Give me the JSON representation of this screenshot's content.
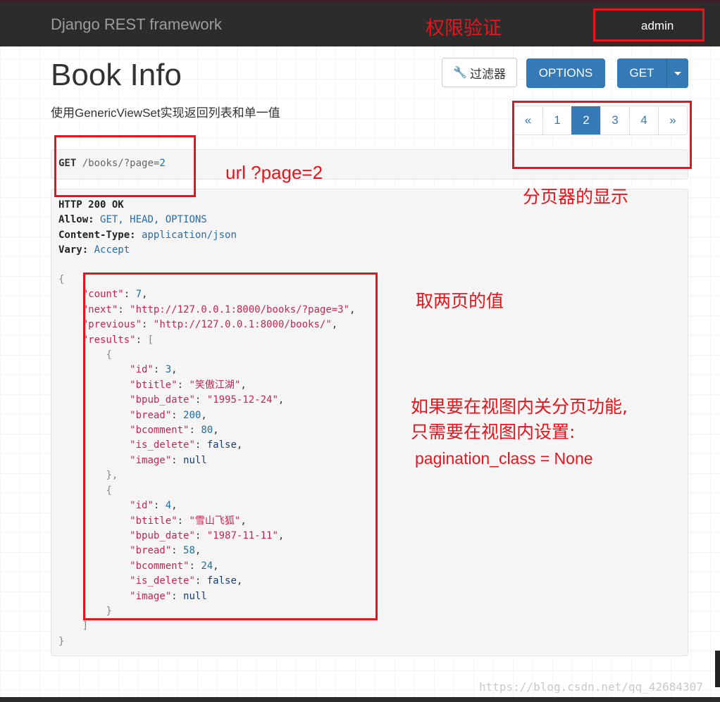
{
  "navbar": {
    "brand": "Django REST framework",
    "user": "admin"
  },
  "page": {
    "title": "Book Info",
    "description": "使用GenericViewSet实现返回列表和单一值"
  },
  "toolbar": {
    "filter_label": "过滤器",
    "options_label": "OPTIONS",
    "get_label": "GET"
  },
  "pagination": {
    "prev": "«",
    "pages": [
      "1",
      "2",
      "3",
      "4"
    ],
    "active": "2",
    "next": "»"
  },
  "request": {
    "method": "GET",
    "path": "/books/?page=",
    "page": "2"
  },
  "response": {
    "status": "HTTP 200 OK",
    "headers": [
      {
        "name": "Allow:",
        "value": "GET, HEAD, OPTIONS"
      },
      {
        "name": "Content-Type:",
        "value": "application/json"
      },
      {
        "name": "Vary:",
        "value": "Accept"
      }
    ],
    "body": {
      "count": 7,
      "next": "http://127.0.0.1:8000/books/?page=3",
      "previous": "http://127.0.0.1:8000/books/",
      "results": [
        {
          "id": 3,
          "btitle": "笑傲江湖",
          "bpub_date": "1995-12-24",
          "bread": 200,
          "bcomment": 80,
          "is_delete": "false",
          "image": "null"
        },
        {
          "id": 4,
          "btitle": "雪山飞狐",
          "bpub_date": "1987-11-11",
          "bread": 58,
          "bcomment": 24,
          "is_delete": "false",
          "image": "null"
        }
      ]
    }
  },
  "annotations": {
    "auth": "权限验证",
    "url": "url  ?page=2",
    "paginator": "分页器的显示",
    "two_pages": "取两页的值",
    "disable_line1": "如果要在视图内关分页功能,",
    "disable_line2": "只需要在视图内设置:",
    "code": "pagination_class = None"
  },
  "watermark": "https://blog.csdn.net/qq_42684307",
  "colors": {
    "navbar": "#2c2c2c",
    "primary": "#337ab7",
    "annotation": "#e8141c"
  }
}
